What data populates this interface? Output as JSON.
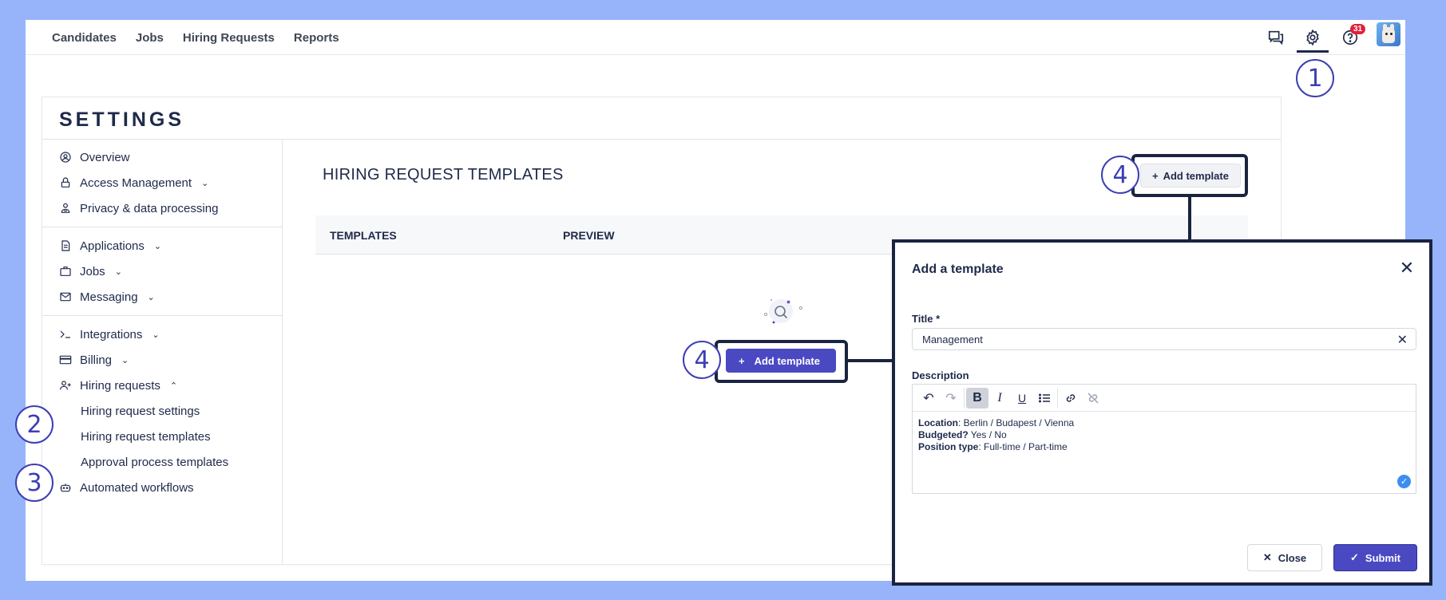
{
  "nav": {
    "links": [
      "Candidates",
      "Jobs",
      "Hiring Requests",
      "Reports"
    ],
    "icons": [
      "chat-icon",
      "gear-icon",
      "help-icon"
    ],
    "help_badge": "31"
  },
  "callouts": {
    "one": "1",
    "two": "2",
    "three": "3",
    "four": "4"
  },
  "settings": {
    "title": "SETTINGS",
    "sidebar": {
      "overview": "Overview",
      "access": "Access Management",
      "privacy": "Privacy & data processing",
      "applications": "Applications",
      "jobs": "Jobs",
      "messaging": "Messaging",
      "integrations": "Integrations",
      "billing": "Billing",
      "hiring_requests": "Hiring requests",
      "hr_settings": "Hiring request settings",
      "hr_templates": "Hiring request templates",
      "approval": "Approval process templates",
      "automated": "Automated workflows"
    },
    "main": {
      "title": "HIRING REQUEST TEMPLATES",
      "add_template": "Add template",
      "columns": [
        "TEMPLATES",
        "PREVIEW"
      ]
    }
  },
  "modal": {
    "title": "Add a template",
    "title_label": "Title",
    "required_mark": "*",
    "title_value": "Management",
    "description_label": "Description",
    "description": [
      {
        "label": "Location",
        "value": ": Berlin / Budapest / Vienna"
      },
      {
        "label": "Budgeted?",
        "value": " Yes / No"
      },
      {
        "label": "Position type",
        "value": ": Full-time / Part-time"
      }
    ],
    "close_label": "Close",
    "submit_label": "Submit"
  },
  "colors": {
    "accent": "#4a49c2",
    "callout": "#3c3fb4",
    "background": "#97b4fb"
  }
}
